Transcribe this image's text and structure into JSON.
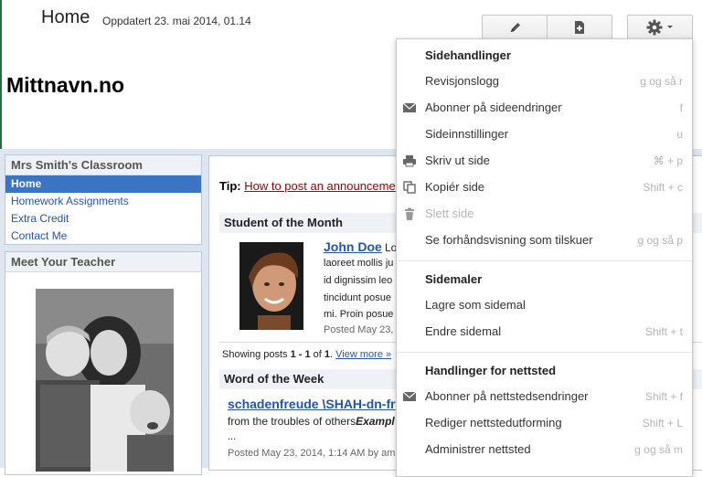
{
  "header": {
    "page_title": "Home",
    "updated": "Oppdatert 23. mai 2014, 01.14",
    "site_name": "Mittnavn.no"
  },
  "toolbar": {
    "edit_icon": "pencil-icon",
    "new_page_icon": "new-page-icon",
    "gear_icon": "gear-icon"
  },
  "sidebar": {
    "title": "Mrs Smith's Classroom",
    "items": [
      {
        "label": "Home",
        "active": true
      },
      {
        "label": "Homework Assignments",
        "active": false
      },
      {
        "label": "Extra Credit",
        "active": false
      },
      {
        "label": "Contact Me",
        "active": false
      }
    ],
    "teacher_title": "Meet Your Teacher"
  },
  "main": {
    "tip_label": "Tip:",
    "tip_link": "How to post an announceme",
    "student_section": "Student of the Month",
    "post1": {
      "title": "John Doe",
      "lines": [
        "Lo",
        "laoreet mollis ju",
        "id dignissim leo",
        "tincidunt posue",
        "mi. Proin posue"
      ],
      "meta": "Posted May 23,"
    },
    "showing": {
      "prefix": "Showing posts ",
      "range": "1 - 1",
      "mid": " of ",
      "total": "1",
      "suffix": ". ",
      "more": "View more »"
    },
    "word_section": "Word of the Week",
    "post2": {
      "title": "schadenfreude \\SHAH-dn-fr",
      "line_plain": "from the troubles of others",
      "line_bold": "Exampl",
      "ellipsis": "...",
      "meta": "Posted May 23, 2014, 1:14 AM by am"
    }
  },
  "menu": {
    "sections": [
      {
        "title": "Sidehandlinger"
      },
      {
        "title": "Sidemaler"
      },
      {
        "title": "Handlinger for nettsted"
      }
    ],
    "items": [
      {
        "label": "Revisjonslogg",
        "shortcut": "g og så r",
        "icon": "",
        "disabled": false
      },
      {
        "label": "Abonner på sideendringer",
        "shortcut": "f",
        "icon": "envelope-icon",
        "disabled": false
      },
      {
        "label": "Sideinnstillinger",
        "shortcut": "u",
        "icon": "",
        "disabled": false
      },
      {
        "label": "Skriv ut side",
        "shortcut": "⌘ + p",
        "icon": "printer-icon",
        "disabled": false
      },
      {
        "label": "Kopiér side",
        "shortcut": "Shift + c",
        "icon": "copy-icon",
        "disabled": false
      },
      {
        "label": "Slett side",
        "shortcut": "",
        "icon": "trash-icon",
        "disabled": true
      },
      {
        "label": "Se forhåndsvisning som tilskuer",
        "shortcut": "g og så p",
        "icon": "",
        "disabled": false
      },
      {
        "label": "Lagre som sidemal",
        "shortcut": "",
        "icon": "",
        "disabled": false
      },
      {
        "label": "Endre sidemal",
        "shortcut": "Shift + t",
        "icon": "",
        "disabled": false
      },
      {
        "label": "Abonner på nettstedsendringer",
        "shortcut": "Shift + f",
        "icon": "envelope-icon",
        "disabled": false
      },
      {
        "label": "Rediger nettstedutforming",
        "shortcut": "Shift + L",
        "icon": "",
        "disabled": false
      },
      {
        "label": "Administrer nettsted",
        "shortcut": "g og så m",
        "icon": "",
        "disabled": false
      }
    ]
  }
}
